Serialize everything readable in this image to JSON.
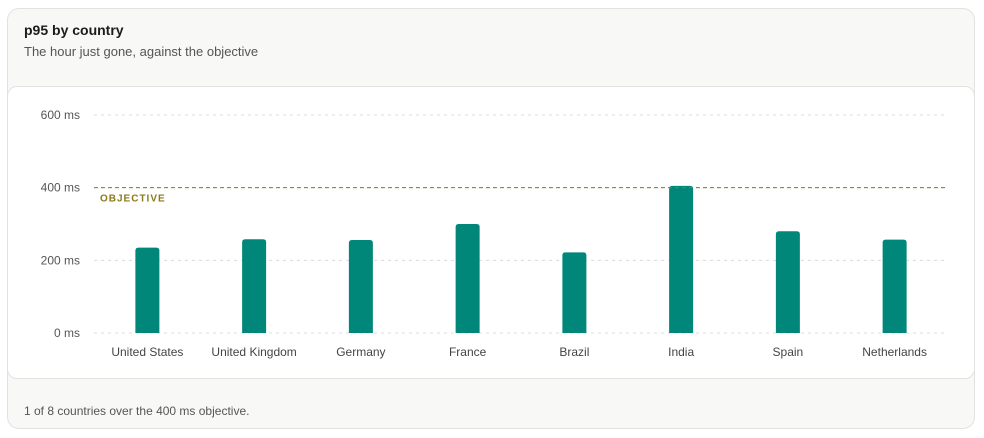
{
  "card": {
    "title": "p95 by country",
    "subtitle": "The hour just gone, against the objective",
    "footer": "1 of 8 countries over the 400 ms objective."
  },
  "colors": {
    "bar": "#00877a",
    "objective": "#8a7a1a",
    "grid": "#dcdcdc"
  },
  "chart_data": {
    "type": "bar",
    "title": "p95 by country",
    "subtitle": "The hour just gone, against the objective",
    "categories": [
      "United States",
      "United Kingdom",
      "Germany",
      "France",
      "Brazil",
      "India",
      "Spain",
      "Netherlands"
    ],
    "values": [
      235,
      258,
      256,
      300,
      222,
      405,
      280,
      257
    ],
    "unit": "ms",
    "ylim": [
      0,
      600
    ],
    "yticks": [
      0,
      200,
      400,
      600
    ],
    "ytick_labels": [
      "0 ms",
      "200 ms",
      "400 ms",
      "600 ms"
    ],
    "grid": true,
    "reference_line": {
      "value": 400,
      "label": "OBJECTIVE",
      "style": "dashed"
    }
  }
}
